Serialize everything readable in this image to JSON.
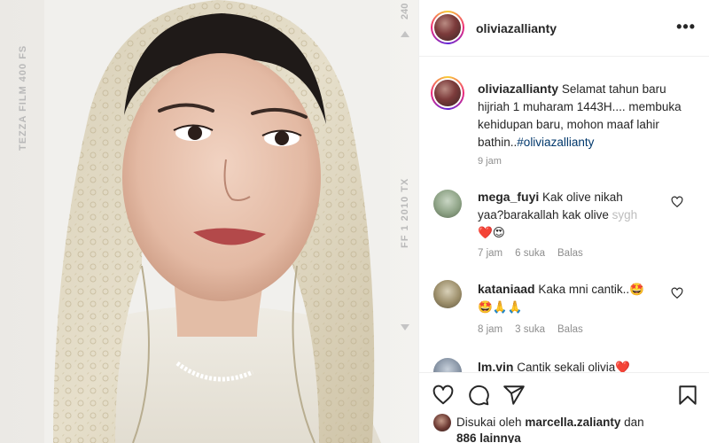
{
  "photo": {
    "film_left": "TEZZA FILM 400 FS",
    "film_right": "FF 1 2010 TX",
    "film_top": "240"
  },
  "post": {
    "username": "oliviazallianty",
    "more_glyph": "•••",
    "caption_user": "oliviazallianty",
    "caption_body": "Selamat tahun baru hijriah 1 muharam 1443H.... membuka kehidupan baru, mohon maaf lahir bathin..",
    "caption_hashtag": "#oliviazallianty",
    "caption_time": "9 jam"
  },
  "comments": [
    {
      "user": "mega_fuyi",
      "text_a": "Kak olive nikah",
      "text_b": "yaa?barakallah kak olive",
      "text_b_faded": " sygh",
      "emoji": "❤️😍",
      "time": "7 jam",
      "likes": "6 suka",
      "reply": "Balas"
    },
    {
      "user": "kataniaad",
      "text": "Kaka mni cantik..🤩",
      "emoji": "🤩🙏🙏",
      "time": "8 jam",
      "likes": "3 suka",
      "reply": "Balas"
    },
    {
      "user": "lm.vin",
      "text": "Cantik sekali olivia❤️"
    }
  ],
  "likes": {
    "prefix": "Disukai oleh",
    "user": "marcella.zalianty",
    "and": "dan",
    "others": "886 lainnya"
  },
  "icons": {
    "like": "heart-icon",
    "comment": "comment-icon",
    "share": "share-icon",
    "save": "bookmark-icon",
    "more": "more-icon"
  },
  "colors": {
    "hashtag": "#00376b",
    "muted": "#8e8e8e",
    "divider": "#efefef"
  }
}
